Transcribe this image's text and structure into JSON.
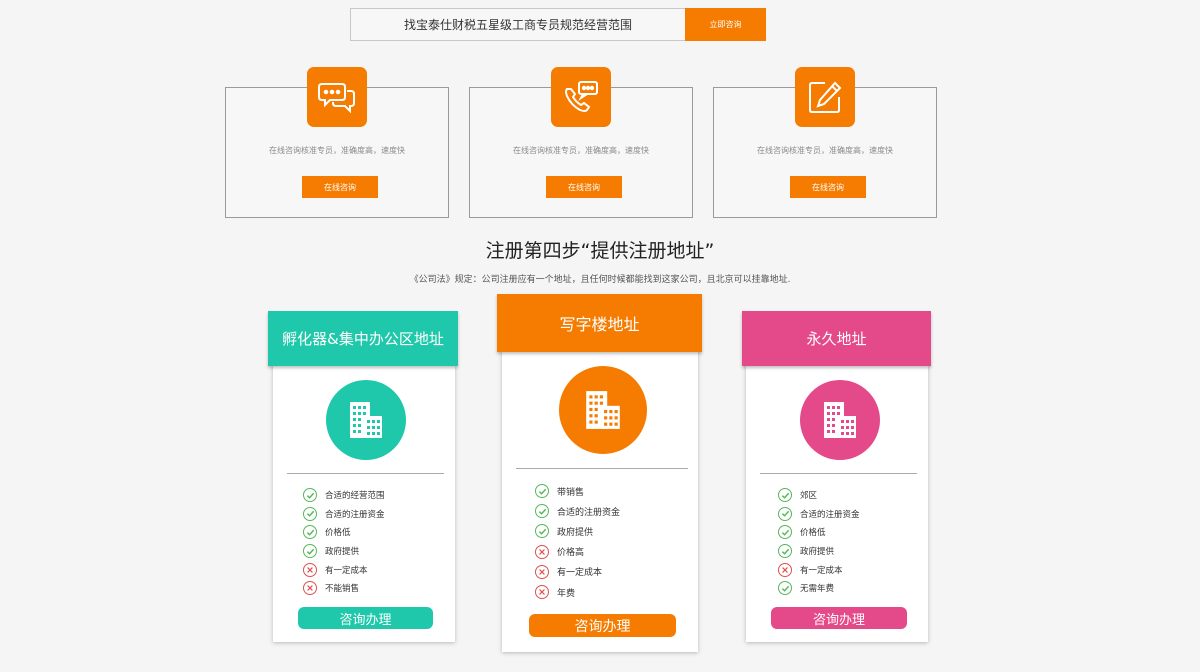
{
  "search": {
    "text": "找宝泰仕财税五星级工商专员规范经营范围",
    "button": "立即咨询"
  },
  "services": [
    {
      "icon": "chat-bubbles-icon",
      "desc": "在线咨询核准专员，准确度高，速度快",
      "button": "在线咨询"
    },
    {
      "icon": "phone-message-icon",
      "desc": "在线咨询核准专员，准确度高，速度快",
      "button": "在线咨询"
    },
    {
      "icon": "edit-pencil-icon",
      "desc": "在线咨询核准专员，准确度高，速度快",
      "button": "在线咨询"
    }
  ],
  "step": {
    "title": "注册第四步“提供注册地址”",
    "subtitle": "《公司法》规定：公司注册应有一个地址，且任何时候都能找到这家公司，且北京可以挂靠地址."
  },
  "plans": [
    {
      "title": "孵化器&集中办公区地址",
      "color": "#1fc8aa",
      "icon": "building-icon",
      "features": [
        {
          "text": "合适的经营范围",
          "ok": true
        },
        {
          "text": "合适的注册资金",
          "ok": true
        },
        {
          "text": "价格低",
          "ok": true
        },
        {
          "text": "政府提供",
          "ok": true
        },
        {
          "text": "有一定成本",
          "ok": false
        },
        {
          "text": "不能销售",
          "ok": false
        }
      ],
      "button": "咨询办理"
    },
    {
      "title": "写字楼地址",
      "color": "#f57c00",
      "icon": "building-icon",
      "features": [
        {
          "text": "带销售",
          "ok": true
        },
        {
          "text": "合适的注册资金",
          "ok": true
        },
        {
          "text": "政府提供",
          "ok": true
        },
        {
          "text": "价格高",
          "ok": false
        },
        {
          "text": "有一定成本",
          "ok": false
        },
        {
          "text": "年费",
          "ok": false
        }
      ],
      "button": "咨询办理"
    },
    {
      "title": "永久地址",
      "color": "#e44a8a",
      "icon": "building-icon",
      "features": [
        {
          "text": "郊区",
          "ok": true
        },
        {
          "text": "合适的注册资金",
          "ok": true
        },
        {
          "text": "价格低",
          "ok": true
        },
        {
          "text": "政府提供",
          "ok": true
        },
        {
          "text": "有一定成本",
          "ok": false
        },
        {
          "text": "无需年费",
          "ok": true
        }
      ],
      "button": "咨询办理"
    }
  ]
}
